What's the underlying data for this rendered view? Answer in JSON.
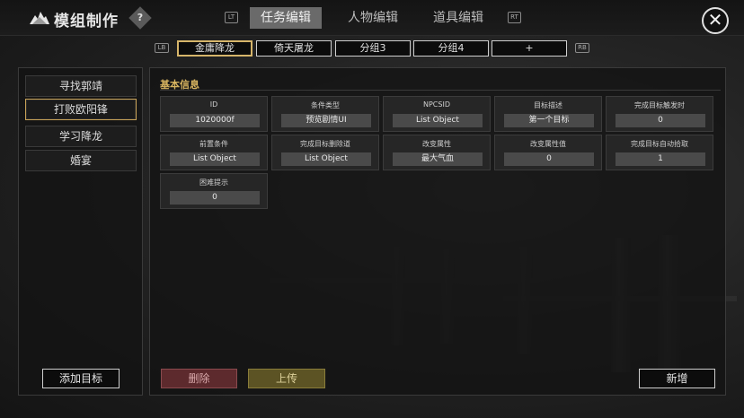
{
  "app": {
    "title": "模组制作",
    "help_label": "?",
    "close_label": "✕"
  },
  "shortcuts": {
    "lt": "LT",
    "rt": "RT",
    "lb": "LB",
    "rb": "RB"
  },
  "main_tabs": [
    {
      "label": "任务编辑",
      "active": true
    },
    {
      "label": "人物编辑",
      "active": false
    },
    {
      "label": "道具编辑",
      "active": false
    }
  ],
  "groups": [
    {
      "label": "金庸降龙",
      "active": true
    },
    {
      "label": "倚天屠龙",
      "active": false
    },
    {
      "label": "分组3",
      "active": false
    },
    {
      "label": "分组4",
      "active": false
    },
    {
      "label": "+",
      "active": false
    }
  ],
  "sidebar": {
    "items": [
      {
        "label": "寻找郭靖",
        "active": false
      },
      {
        "label": "打败欧阳锋",
        "active": true
      },
      {
        "label": "学习降龙",
        "active": false
      },
      {
        "label": "婚宴",
        "active": false
      }
    ],
    "add_label": "添加目标"
  },
  "section": {
    "title": "基本信息"
  },
  "fields": [
    {
      "label": "ID",
      "value": "1020000f"
    },
    {
      "label": "条件类型",
      "value": "预览剧情UI"
    },
    {
      "label": "NPCSID",
      "value": "List Object"
    },
    {
      "label": "目标描述",
      "value": "第一个目标"
    },
    {
      "label": "完成目标触发时",
      "value": "0"
    },
    {
      "label": "前置条件",
      "value": "List Object"
    },
    {
      "label": "完成目标删除道",
      "value": "List Object"
    },
    {
      "label": "改变属性",
      "value": "最大气血"
    },
    {
      "label": "改变属性值",
      "value": "0"
    },
    {
      "label": "完成目标自动拾取",
      "value": "1"
    },
    {
      "label": "困难提示",
      "value": "0"
    }
  ],
  "actions": {
    "delete_label": "删除",
    "upload_label": "上传",
    "new_label": "新增"
  },
  "colors": {
    "accent_gold": "#d9b560",
    "delete_red": "#5d2a2d",
    "upload_olive": "#5c5324"
  }
}
